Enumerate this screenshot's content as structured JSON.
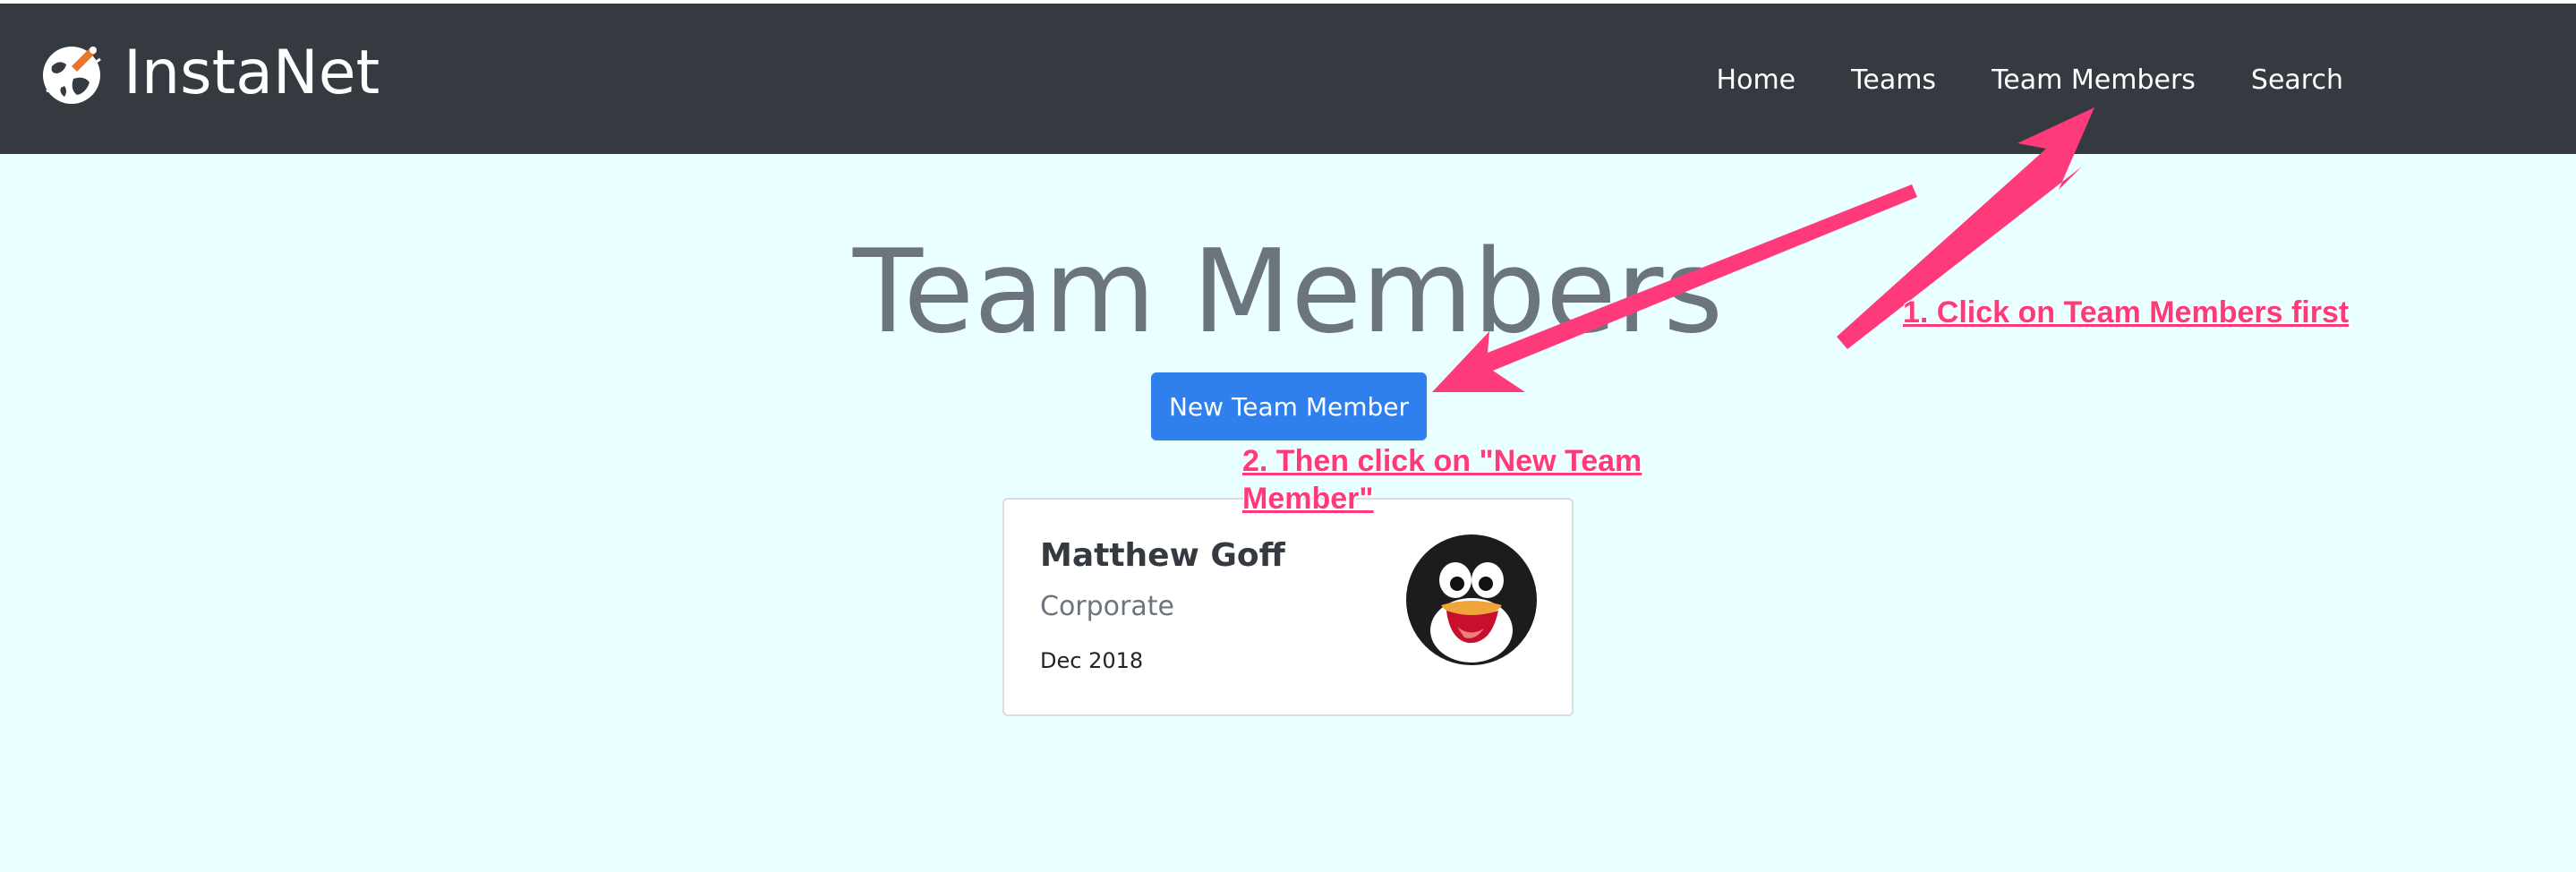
{
  "navbar": {
    "brand": "InstaNet",
    "links": [
      "Home",
      "Teams",
      "Team Members",
      "Search"
    ]
  },
  "page": {
    "title": "Team Members",
    "new_button_label": "New Team Member"
  },
  "card": {
    "name": "Matthew Goff",
    "team": "Corporate",
    "date": "Dec 2018"
  },
  "annotations": {
    "step1": "1. Click on Team Members first",
    "step2": "2. Then click on \"New Team Member\""
  },
  "colors": {
    "navbar_bg": "#343a40",
    "page_bg": "#eaffff",
    "button_bg": "#2f80ed",
    "annotation": "#ff3a7a"
  },
  "icons": {
    "brand": "globe-rocket-icon",
    "avatar": "penguin-avatar"
  }
}
